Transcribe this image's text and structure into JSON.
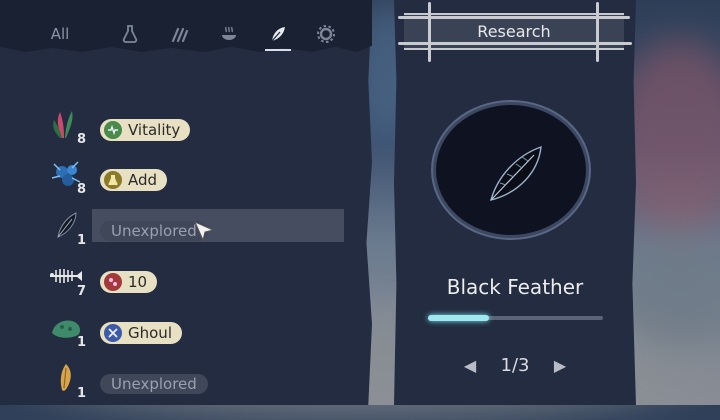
{
  "tabs": {
    "all_label": "All",
    "icons": [
      "flask-icon",
      "claw-icon",
      "steaming-bowl-icon",
      "feather-leaf-icon",
      "gear-icon"
    ],
    "active": "feather-leaf-icon"
  },
  "ingredients": [
    {
      "name": "red-plant",
      "count": "8",
      "tag": "Vitality",
      "tag_icon": "vitality-icon",
      "tag_color": "#4a8a4a"
    },
    {
      "name": "blue-berries",
      "count": "8",
      "tag": "Add",
      "tag_icon": "flask-icon",
      "tag_color": "#8a7a2a"
    },
    {
      "name": "black-feather",
      "count": "1",
      "tag": "Unexplored",
      "tag_icon": null,
      "selected": true
    },
    {
      "name": "fish-skeleton",
      "count": "7",
      "tag": "10",
      "tag_icon": "damage-icon",
      "tag_color": "#a23a3a"
    },
    {
      "name": "green-moss",
      "count": "1",
      "tag": "Ghoul",
      "tag_icon": "ghoul-icon",
      "tag_color": "#3c5aa8"
    },
    {
      "name": "root",
      "count": "1",
      "tag": "Unexplored",
      "tag_icon": null
    }
  ],
  "research": {
    "header": "Research",
    "item_name": "Black Feather",
    "progress": 0.35,
    "page": "1/3"
  }
}
